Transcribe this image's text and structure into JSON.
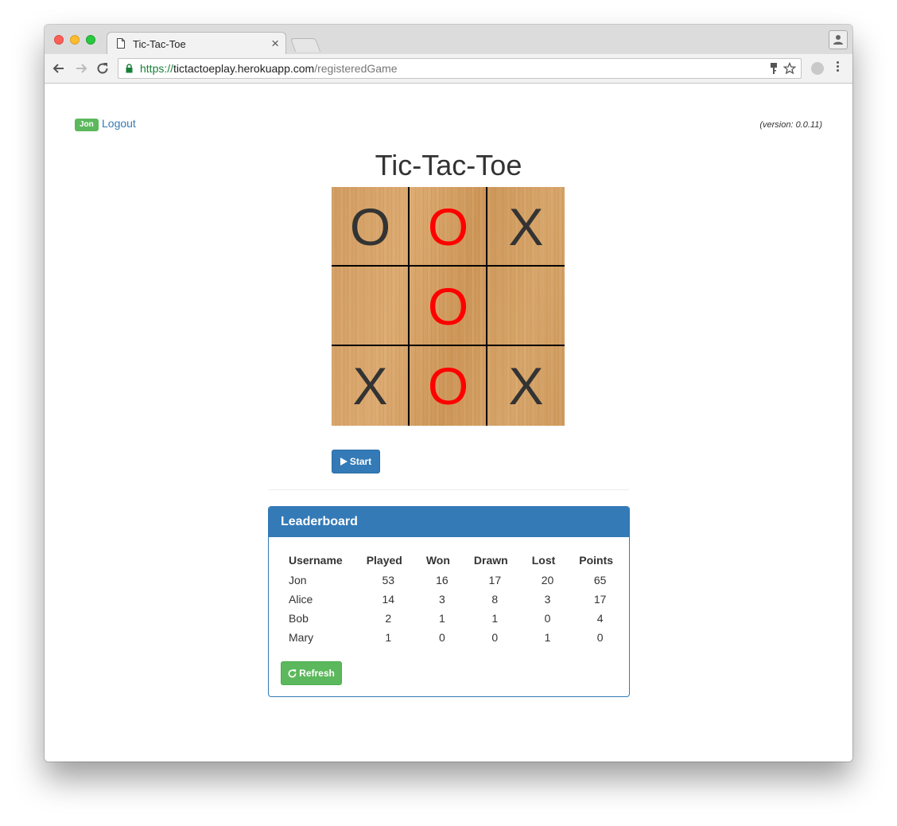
{
  "browser": {
    "tab_title": "Tic-Tac-Toe",
    "tab_close": "×",
    "url_scheme": "https://",
    "url_host": "tictactoeplay.herokuapp.com",
    "url_path": "/registeredGame"
  },
  "header": {
    "user_badge": "Jon",
    "logout_label": "Logout",
    "version": "(version: 0.0.11)"
  },
  "page_title": "Tic-Tac-Toe",
  "board": {
    "x_color": "#333333",
    "o_color": "#ff0000",
    "cells": [
      {
        "mark": "O",
        "color": "#333333"
      },
      {
        "mark": "O",
        "color": "#ff0000"
      },
      {
        "mark": "X",
        "color": "#333333"
      },
      {
        "mark": "",
        "color": "#333333"
      },
      {
        "mark": "O",
        "color": "#ff0000"
      },
      {
        "mark": "",
        "color": "#333333"
      },
      {
        "mark": "X",
        "color": "#333333"
      },
      {
        "mark": "O",
        "color": "#ff0000"
      },
      {
        "mark": "X",
        "color": "#333333"
      }
    ]
  },
  "start_button": {
    "label": "Start",
    "icon": "play-icon"
  },
  "leaderboard": {
    "title": "Leaderboard",
    "columns": [
      "Username",
      "Played",
      "Won",
      "Drawn",
      "Lost",
      "Points"
    ],
    "rows": [
      [
        "Jon",
        "53",
        "16",
        "17",
        "20",
        "65"
      ],
      [
        "Alice",
        "14",
        "3",
        "8",
        "3",
        "17"
      ],
      [
        "Bob",
        "2",
        "1",
        "1",
        "0",
        "4"
      ],
      [
        "Mary",
        "1",
        "0",
        "0",
        "1",
        "0"
      ]
    ],
    "refresh_label": "Refresh",
    "refresh_icon": "refresh-icon"
  },
  "colors": {
    "primary": "#337ab7",
    "success": "#5cb85c"
  }
}
